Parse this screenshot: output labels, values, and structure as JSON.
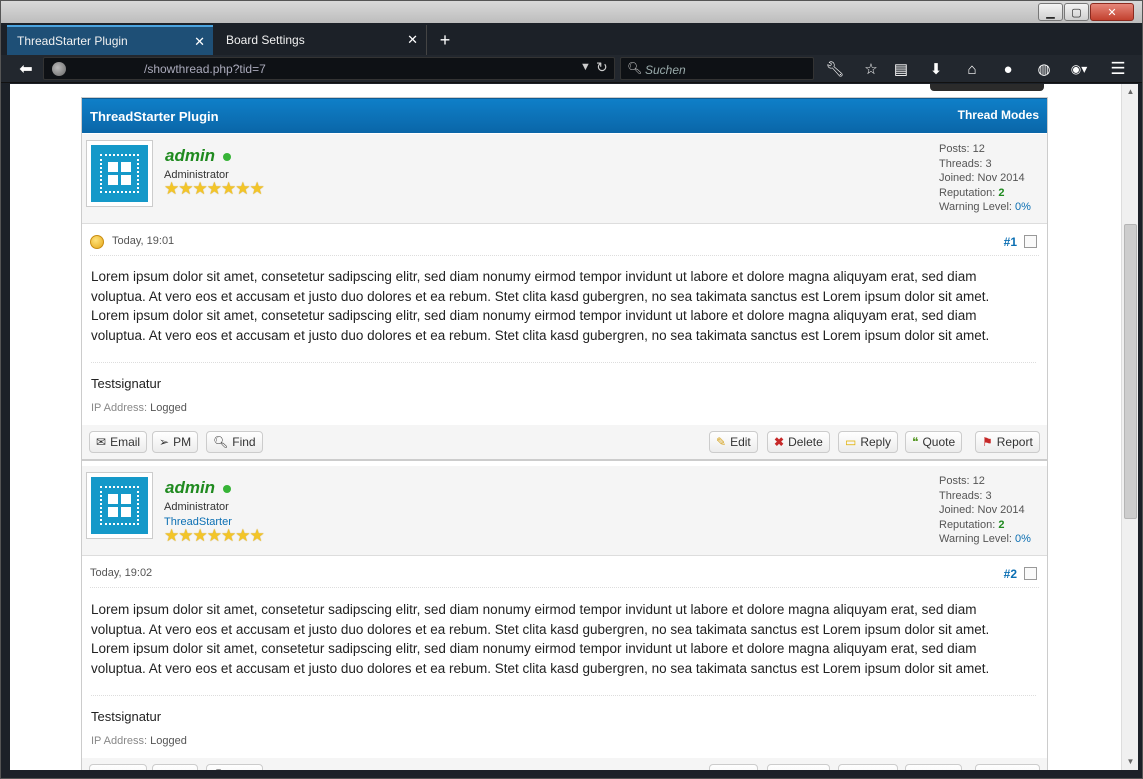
{
  "browser": {
    "tabs": [
      {
        "label": "ThreadStarter Plugin",
        "active": true
      },
      {
        "label": "Board Settings",
        "active": false
      }
    ],
    "url": "/showthread.php?tid=7",
    "search_placeholder": "Suchen",
    "accent": "#4aa3df"
  },
  "thread": {
    "title": "ThreadStarter Plugin",
    "modes_label": "Thread Modes",
    "header_color": "#0a66a8"
  },
  "posts": [
    {
      "author": "admin",
      "user_title": "Administrator",
      "user_link": "",
      "stars": "★★★★★★★",
      "stats": {
        "posts_label": "Posts:",
        "posts": "12",
        "threads_label": "Threads:",
        "threads": "3",
        "joined_label": "Joined:",
        "joined": "Nov 2014",
        "rep_label": "Reputation:",
        "reputation": "2",
        "warn_label": "Warning Level:",
        "warning": "0%"
      },
      "date": "Today, 19:01",
      "number": "#1",
      "body": "Lorem ipsum dolor sit amet, consetetur sadipscing elitr, sed diam nonumy eirmod tempor invidunt ut labore et dolore magna aliquyam erat, sed diam voluptua. At vero eos et accusam et justo duo dolores et ea rebum. Stet clita kasd gubergren, no sea takimata sanctus est Lorem ipsum dolor sit amet. Lorem ipsum dolor sit amet, consetetur sadipscing elitr, sed diam nonumy eirmod tempor invidunt ut labore et dolore magna aliquyam erat, sed diam voluptua. At vero eos et accusam et justo duo dolores et ea rebum. Stet clita kasd gubergren, no sea takimata sanctus est Lorem ipsum dolor sit amet.",
      "signature": "Testsignatur",
      "ip_label": "IP Address:",
      "ip_value": "Logged"
    },
    {
      "author": "admin",
      "user_title": "Administrator",
      "user_link": "ThreadStarter",
      "stars": "★★★★★★★",
      "stats": {
        "posts_label": "Posts:",
        "posts": "12",
        "threads_label": "Threads:",
        "threads": "3",
        "joined_label": "Joined:",
        "joined": "Nov 2014",
        "rep_label": "Reputation:",
        "reputation": "2",
        "warn_label": "Warning Level:",
        "warning": "0%"
      },
      "date": "Today, 19:02",
      "number": "#2",
      "body": "Lorem ipsum dolor sit amet, consetetur sadipscing elitr, sed diam nonumy eirmod tempor invidunt ut labore et dolore magna aliquyam erat, sed diam voluptua. At vero eos et accusam et justo duo dolores et ea rebum. Stet clita kasd gubergren, no sea takimata sanctus est Lorem ipsum dolor sit amet. Lorem ipsum dolor sit amet, consetetur sadipscing elitr, sed diam nonumy eirmod tempor invidunt ut labore et dolore magna aliquyam erat, sed diam voluptua. At vero eos et accusam et justo duo dolores et ea rebum. Stet clita kasd gubergren, no sea takimata sanctus est Lorem ipsum dolor sit amet.",
      "signature": "Testsignatur",
      "ip_label": "IP Address:",
      "ip_value": "Logged"
    }
  ],
  "actions": {
    "email": "Email",
    "pm": "PM",
    "find": "Find",
    "edit": "Edit",
    "delete": "Delete",
    "reply": "Reply",
    "quote": "Quote",
    "report": "Report"
  },
  "icons": [
    "back-arrow-icon",
    "site-identity-icon",
    "dropdown-icon",
    "reload-icon",
    "search-icon",
    "wrench-icon",
    "bookmark-star-icon",
    "reading-list-icon",
    "download-icon",
    "home-icon",
    "chat-icon",
    "globe-icon",
    "avatar-icon",
    "menu-icon",
    "smiley-icon",
    "email-icon",
    "pm-icon",
    "find-icon",
    "edit-icon",
    "delete-icon",
    "reply-icon",
    "quote-icon",
    "report-icon"
  ]
}
